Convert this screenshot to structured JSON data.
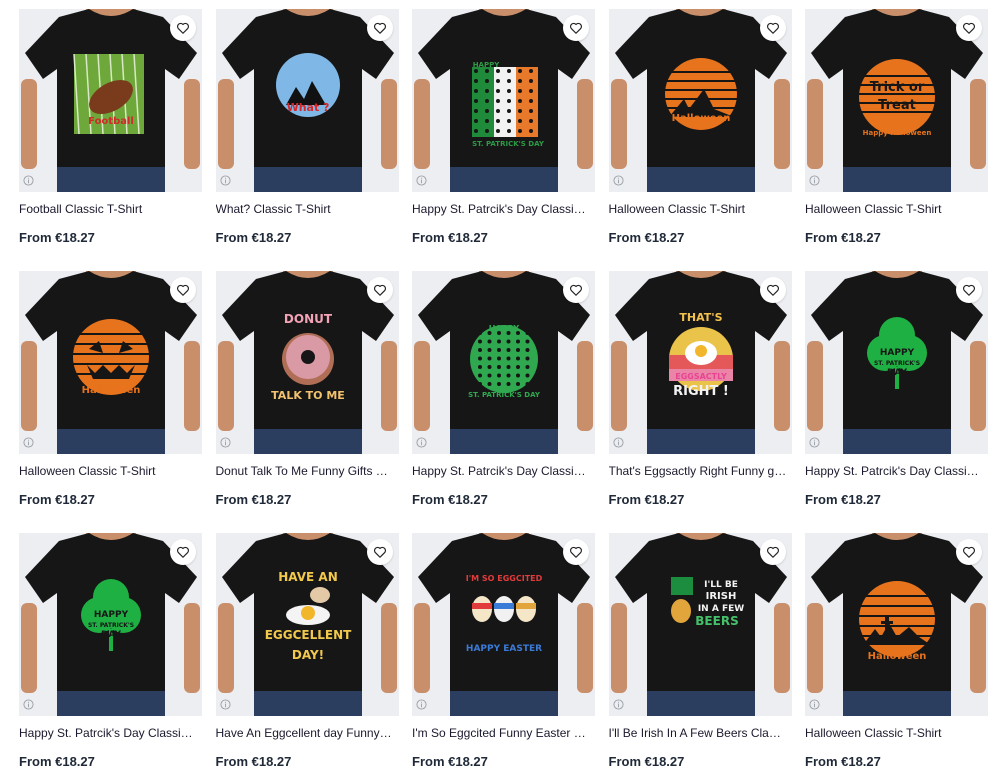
{
  "colors": {
    "tile_bg": "#eceef2",
    "shirt": "#161616",
    "title": "#1a1a2e",
    "price": "#1f2937"
  },
  "products": [
    {
      "title": "Football Classic T-Shirt",
      "price": "From €18.27",
      "design": "football",
      "design_text": [
        "Football"
      ]
    },
    {
      "title": "What? Classic T-Shirt",
      "price": "From €18.27",
      "design": "what",
      "design_text": [
        "What ?"
      ]
    },
    {
      "title": "Happy St. Patrcik's Day Classic T-Shirt",
      "price": "From €18.27",
      "design": "flag",
      "design_text": [
        "HAPPY",
        "ST. PATRICK'S DAY"
      ]
    },
    {
      "title": "Halloween Classic T-Shirt",
      "price": "From €18.27",
      "design": "halloween_moon",
      "design_text": [
        "Halloween"
      ]
    },
    {
      "title": "Halloween Classic T-Shirt",
      "price": "From €18.27",
      "design": "trick",
      "design_text": [
        "Trick or",
        "Treat",
        "Happy Halloween"
      ]
    },
    {
      "title": "Halloween Classic T-Shirt",
      "price": "From €18.27",
      "design": "pumpkin",
      "design_text": [
        "Halloween"
      ]
    },
    {
      "title": "Donut Talk To Me Funny Gifts Classic T-Shirt",
      "price": "From €18.27",
      "design": "donut",
      "design_text": [
        "DONUT",
        "TALK TO ME"
      ]
    },
    {
      "title": "Happy St. Patrcik's Day Classic T-Shirt",
      "price": "From €18.27",
      "design": "green_circle",
      "design_text": [
        "HAPPY",
        "ST. PATRICK'S DAY"
      ]
    },
    {
      "title": "That's Eggsactly Right Funny gifts Classic T-Shirt",
      "price": "From €18.27",
      "design": "eggsactly",
      "design_text": [
        "THAT'S",
        "EGGSACTLY",
        "RIGHT !"
      ]
    },
    {
      "title": "Happy St. Patrcik's Day Classic T-Shirt",
      "price": "From €18.27",
      "design": "clover",
      "design_text": [
        "HAPPY",
        "ST. PATRICK'S",
        "DAY"
      ]
    },
    {
      "title": "Happy St. Patrcik's Day Classic T-Shirt",
      "price": "From €18.27",
      "design": "clover_green",
      "design_text": [
        "HAPPY",
        "ST. PATRICK'S",
        "DAY"
      ]
    },
    {
      "title": "Have An Eggcellent day Funny gifts Classic T-Shirt",
      "price": "From €18.27",
      "design": "eggcellent",
      "design_text": [
        "HAVE AN",
        "EGGCELLENT",
        "DAY!"
      ]
    },
    {
      "title": "I'm So Eggcited Funny Easter Gifts Classic T-Shirt",
      "price": "From €18.27",
      "design": "eggcited",
      "design_text": [
        "I'M SO EGGCITED",
        "HAPPY EASTER"
      ]
    },
    {
      "title": "I'll Be Irish In A Few Beers Classic T-Shirt",
      "price": "From €18.27",
      "design": "irish",
      "design_text": [
        "I'LL BE",
        "IRISH",
        "IN A FEW",
        "BEERS"
      ]
    },
    {
      "title": "Halloween Classic T-Shirt",
      "price": "From €18.27",
      "design": "halloween_graveyard",
      "design_text": [
        "Halloween"
      ]
    }
  ]
}
